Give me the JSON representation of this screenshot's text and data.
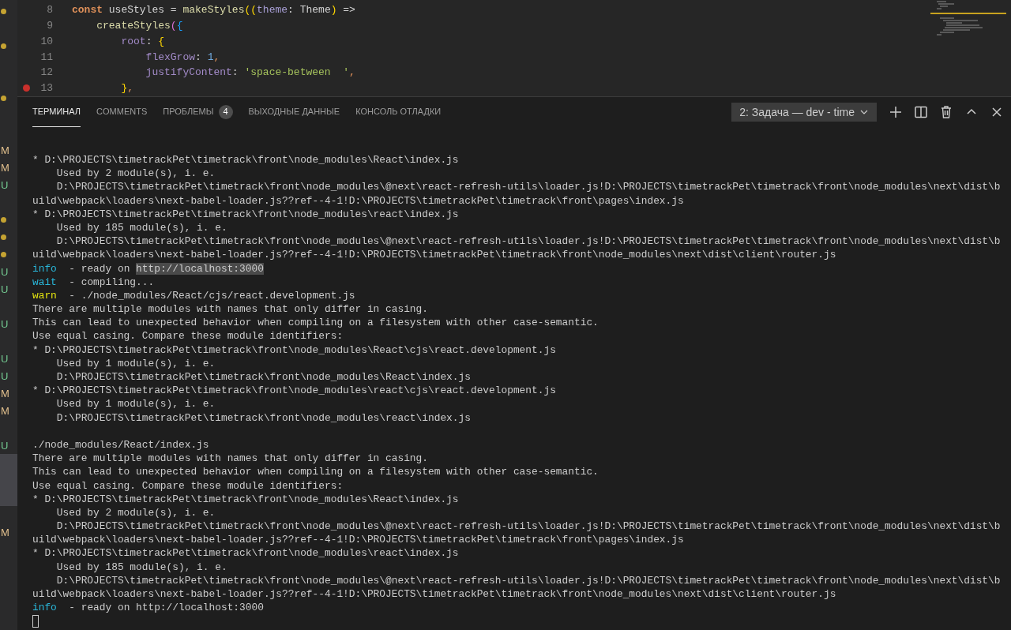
{
  "sidebar": {
    "rows": [
      {
        "kind": "dot"
      },
      {
        "kind": "empty"
      },
      {
        "kind": "dot"
      },
      {
        "kind": "empty"
      },
      {
        "kind": "empty"
      },
      {
        "kind": "dot"
      },
      {
        "kind": "empty"
      },
      {
        "kind": "empty"
      },
      {
        "kind": "letter",
        "text": "M",
        "color": "#e2c08d"
      },
      {
        "kind": "letter",
        "text": "M",
        "color": "#e2c08d"
      },
      {
        "kind": "letter",
        "text": "U",
        "color": "#73c991"
      },
      {
        "kind": "empty"
      },
      {
        "kind": "dot"
      },
      {
        "kind": "dot"
      },
      {
        "kind": "dot"
      },
      {
        "kind": "letter",
        "text": "U",
        "color": "#73c991"
      },
      {
        "kind": "letter",
        "text": "U",
        "color": "#73c991"
      },
      {
        "kind": "empty"
      },
      {
        "kind": "letter",
        "text": "U",
        "color": "#73c991"
      },
      {
        "kind": "empty"
      },
      {
        "kind": "letter",
        "text": "U",
        "color": "#73c991"
      },
      {
        "kind": "letter",
        "text": "U",
        "color": "#73c991"
      },
      {
        "kind": "letter",
        "text": "M",
        "color": "#e2c08d"
      },
      {
        "kind": "letter",
        "text": "M",
        "color": "#e2c08d"
      },
      {
        "kind": "empty"
      },
      {
        "kind": "letter",
        "text": "U",
        "color": "#73c991"
      },
      {
        "kind": "highlight"
      },
      {
        "kind": "highlight"
      },
      {
        "kind": "highlight"
      },
      {
        "kind": "empty"
      },
      {
        "kind": "letter",
        "text": "M",
        "color": "#e2c08d"
      }
    ]
  },
  "editor": {
    "lines": [
      {
        "number": "8",
        "breakpoint": false,
        "tokens": [
          {
            "text": "const",
            "kind": "keyword"
          },
          {
            "text": " useStyles = ",
            "kind": "plain"
          },
          {
            "text": "makeStyles",
            "kind": "function"
          },
          {
            "text": "((",
            "kind": "bracket1"
          },
          {
            "text": "theme",
            "kind": "param"
          },
          {
            "text": ": Theme",
            "kind": "plain"
          },
          {
            "text": ")",
            "kind": "bracket1"
          },
          {
            "text": " =>",
            "kind": "plain"
          }
        ]
      },
      {
        "number": "9",
        "breakpoint": false,
        "tokens": [
          {
            "text": "    createStyles",
            "kind": "function"
          },
          {
            "text": "(",
            "kind": "bracket2"
          },
          {
            "text": "{",
            "kind": "bracket3"
          }
        ]
      },
      {
        "number": "10",
        "breakpoint": false,
        "tokens": [
          {
            "text": "        root",
            "kind": "property"
          },
          {
            "text": ": ",
            "kind": "plain"
          },
          {
            "text": "{",
            "kind": "bracket1"
          }
        ]
      },
      {
        "number": "11",
        "breakpoint": false,
        "tokens": [
          {
            "text": "            flexGrow",
            "kind": "property"
          },
          {
            "text": ": ",
            "kind": "plain"
          },
          {
            "text": "1",
            "kind": "number"
          },
          {
            "text": ",",
            "kind": "punct"
          }
        ]
      },
      {
        "number": "12",
        "breakpoint": false,
        "tokens": [
          {
            "text": "            justifyContent",
            "kind": "property"
          },
          {
            "text": ": ",
            "kind": "plain"
          },
          {
            "text": "'space-between  '",
            "kind": "string"
          },
          {
            "text": ",",
            "kind": "punct"
          }
        ]
      },
      {
        "number": "13",
        "breakpoint": true,
        "tokens": [
          {
            "text": "        }",
            "kind": "bracket1"
          },
          {
            "text": ",",
            "kind": "punct"
          }
        ]
      }
    ]
  },
  "panel": {
    "tabs": [
      {
        "label": "ТЕРМИНАЛ",
        "selected": true
      },
      {
        "label": "COMMENTS",
        "selected": false
      },
      {
        "label": "ПРОБЛЕМЫ",
        "badge": "4",
        "selected": false
      },
      {
        "label": "ВЫХОДНЫЕ ДАННЫЕ",
        "selected": false
      },
      {
        "label": "КОНСОЛЬ ОТЛАДКИ",
        "selected": false
      }
    ],
    "terminal_select": "2: Задача — dev - time"
  },
  "terminal": {
    "lines": [
      {
        "kind": "text",
        "segments": [
          {
            "text": "* D:\\PROJECTS\\timetrackPet\\timetrack\\front\\node_modules\\React\\index.js",
            "kind": "plain"
          }
        ]
      },
      {
        "kind": "text",
        "segments": [
          {
            "text": "    Used by 2 module(s), i. e.",
            "kind": "plain"
          }
        ]
      },
      {
        "kind": "text",
        "segments": [
          {
            "text": "    D:\\PROJECTS\\timetrackPet\\timetrack\\front\\node_modules\\@next\\react-refresh-utils\\loader.js!D:\\PROJECTS\\timetrackPet\\timetrack\\front\\node_modules\\next\\dist\\b",
            "kind": "plain"
          }
        ]
      },
      {
        "kind": "text",
        "segments": [
          {
            "text": "uild\\webpack\\loaders\\next-babel-loader.js??ref--4-1!D:\\PROJECTS\\timetrackPet\\timetrack\\front\\pages\\index.js",
            "kind": "plain"
          }
        ]
      },
      {
        "kind": "text",
        "segments": [
          {
            "text": "* D:\\PROJECTS\\timetrackPet\\timetrack\\front\\node_modules\\react\\index.js",
            "kind": "plain"
          }
        ]
      },
      {
        "kind": "text",
        "segments": [
          {
            "text": "    Used by 185 module(s), i. e.",
            "kind": "plain"
          }
        ]
      },
      {
        "kind": "text",
        "segments": [
          {
            "text": "    D:\\PROJECTS\\timetrackPet\\timetrack\\front\\node_modules\\@next\\react-refresh-utils\\loader.js!D:\\PROJECTS\\timetrackPet\\timetrack\\front\\node_modules\\next\\dist\\b",
            "kind": "plain"
          }
        ]
      },
      {
        "kind": "text",
        "segments": [
          {
            "text": "uild\\webpack\\loaders\\next-babel-loader.js??ref--4-1!D:\\PROJECTS\\timetrackPet\\timetrack\\front\\node_modules\\next\\dist\\client\\router.js",
            "kind": "plain"
          }
        ]
      },
      {
        "kind": "text",
        "segments": [
          {
            "text": "info",
            "kind": "info"
          },
          {
            "text": "  - ready on ",
            "kind": "plain"
          },
          {
            "text": "http://localhost:3000",
            "kind": "highlight"
          }
        ]
      },
      {
        "kind": "text",
        "segments": [
          {
            "text": "wait",
            "kind": "info"
          },
          {
            "text": "  - compiling...",
            "kind": "plain"
          }
        ]
      },
      {
        "kind": "text",
        "segments": [
          {
            "text": "warn",
            "kind": "warn"
          },
          {
            "text": "  - ./node_modules/React/cjs/react.development.js",
            "kind": "plain"
          }
        ]
      },
      {
        "kind": "text",
        "segments": [
          {
            "text": "There are multiple modules with names that only differ in casing.",
            "kind": "plain"
          }
        ]
      },
      {
        "kind": "text",
        "segments": [
          {
            "text": "This can lead to unexpected behavior when compiling on a filesystem with other case-semantic.",
            "kind": "plain"
          }
        ]
      },
      {
        "kind": "text",
        "segments": [
          {
            "text": "Use equal casing. Compare these module identifiers:",
            "kind": "plain"
          }
        ]
      },
      {
        "kind": "text",
        "segments": [
          {
            "text": "* D:\\PROJECTS\\timetrackPet\\timetrack\\front\\node_modules\\React\\cjs\\react.development.js",
            "kind": "plain"
          }
        ]
      },
      {
        "kind": "text",
        "segments": [
          {
            "text": "    Used by 1 module(s), i. e.",
            "kind": "plain"
          }
        ]
      },
      {
        "kind": "text",
        "segments": [
          {
            "text": "    D:\\PROJECTS\\timetrackPet\\timetrack\\front\\node_modules\\React\\index.js",
            "kind": "plain"
          }
        ]
      },
      {
        "kind": "text",
        "segments": [
          {
            "text": "* D:\\PROJECTS\\timetrackPet\\timetrack\\front\\node_modules\\react\\cjs\\react.development.js",
            "kind": "plain"
          }
        ]
      },
      {
        "kind": "text",
        "segments": [
          {
            "text": "    Used by 1 module(s), i. e.",
            "kind": "plain"
          }
        ]
      },
      {
        "kind": "text",
        "segments": [
          {
            "text": "    D:\\PROJECTS\\timetrackPet\\timetrack\\front\\node_modules\\react\\index.js",
            "kind": "plain"
          }
        ]
      },
      {
        "kind": "blank"
      },
      {
        "kind": "text",
        "segments": [
          {
            "text": "./node_modules/React/index.js",
            "kind": "plain"
          }
        ]
      },
      {
        "kind": "text",
        "segments": [
          {
            "text": "There are multiple modules with names that only differ in casing.",
            "kind": "plain"
          }
        ]
      },
      {
        "kind": "text",
        "segments": [
          {
            "text": "This can lead to unexpected behavior when compiling on a filesystem with other case-semantic.",
            "kind": "plain"
          }
        ]
      },
      {
        "kind": "text",
        "segments": [
          {
            "text": "Use equal casing. Compare these module identifiers:",
            "kind": "plain"
          }
        ]
      },
      {
        "kind": "text",
        "segments": [
          {
            "text": "* D:\\PROJECTS\\timetrackPet\\timetrack\\front\\node_modules\\React\\index.js",
            "kind": "plain"
          }
        ]
      },
      {
        "kind": "text",
        "segments": [
          {
            "text": "    Used by 2 module(s), i. e.",
            "kind": "plain"
          }
        ]
      },
      {
        "kind": "text",
        "segments": [
          {
            "text": "    D:\\PROJECTS\\timetrackPet\\timetrack\\front\\node_modules\\@next\\react-refresh-utils\\loader.js!D:\\PROJECTS\\timetrackPet\\timetrack\\front\\node_modules\\next\\dist\\b",
            "kind": "plain"
          }
        ]
      },
      {
        "kind": "text",
        "segments": [
          {
            "text": "uild\\webpack\\loaders\\next-babel-loader.js??ref--4-1!D:\\PROJECTS\\timetrackPet\\timetrack\\front\\pages\\index.js",
            "kind": "plain"
          }
        ]
      },
      {
        "kind": "text",
        "segments": [
          {
            "text": "* D:\\PROJECTS\\timetrackPet\\timetrack\\front\\node_modules\\react\\index.js",
            "kind": "plain"
          }
        ]
      },
      {
        "kind": "text",
        "segments": [
          {
            "text": "    Used by 185 module(s), i. e.",
            "kind": "plain"
          }
        ]
      },
      {
        "kind": "text",
        "segments": [
          {
            "text": "    D:\\PROJECTS\\timetrackPet\\timetrack\\front\\node_modules\\@next\\react-refresh-utils\\loader.js!D:\\PROJECTS\\timetrackPet\\timetrack\\front\\node_modules\\next\\dist\\b",
            "kind": "plain"
          }
        ]
      },
      {
        "kind": "text",
        "segments": [
          {
            "text": "uild\\webpack\\loaders\\next-babel-loader.js??ref--4-1!D:\\PROJECTS\\timetrackPet\\timetrack\\front\\node_modules\\next\\dist\\client\\router.js",
            "kind": "plain"
          }
        ]
      },
      {
        "kind": "text",
        "segments": [
          {
            "text": "info",
            "kind": "info"
          },
          {
            "text": "  - ready on http://localhost:3000",
            "kind": "plain"
          }
        ]
      },
      {
        "kind": "cursor"
      }
    ]
  }
}
